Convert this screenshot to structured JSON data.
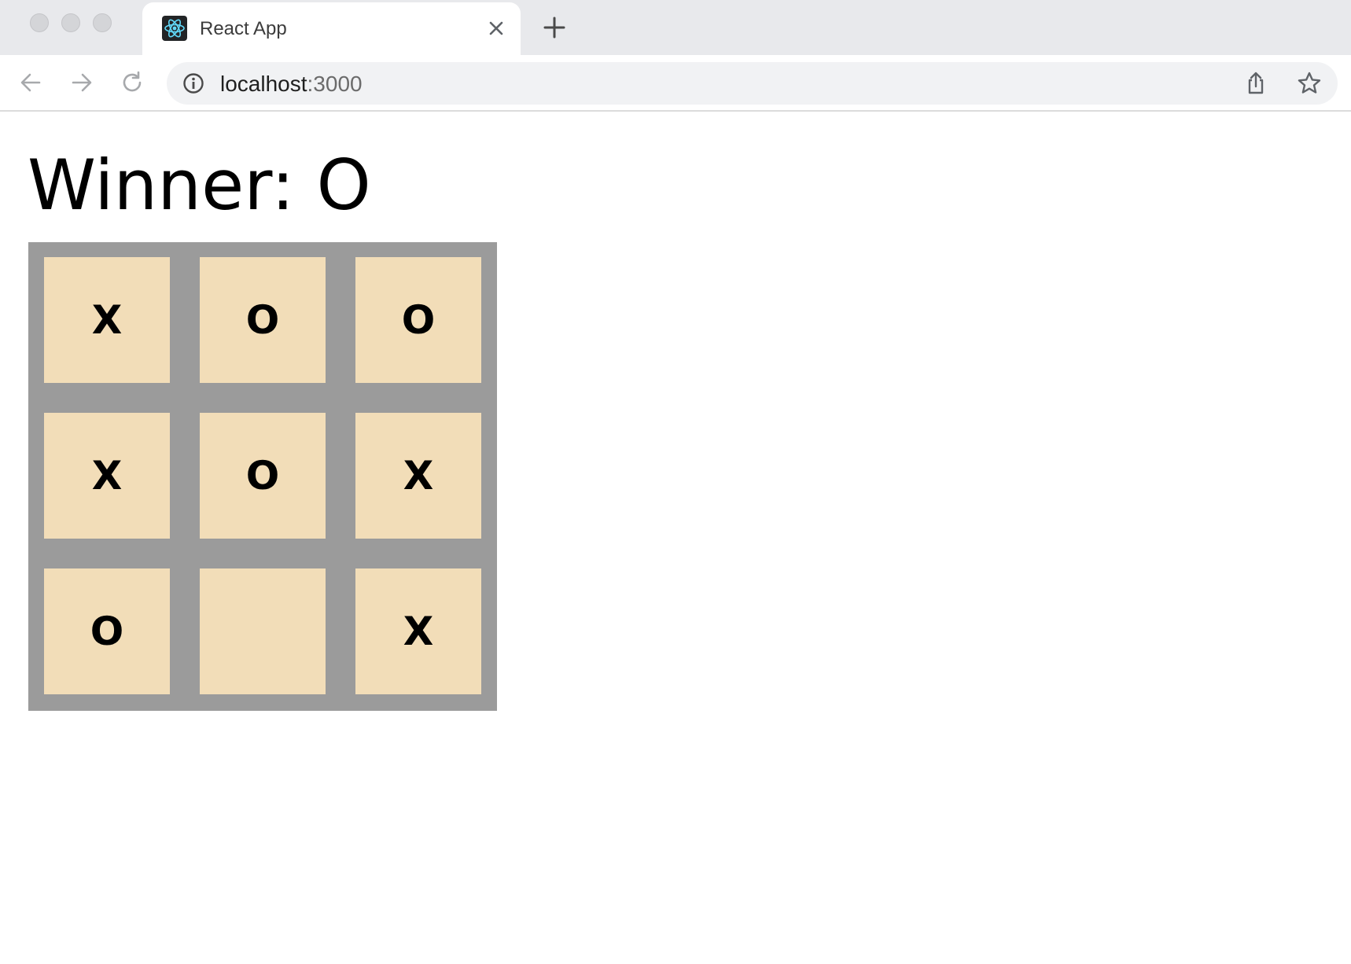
{
  "browser": {
    "tab": {
      "title": "React App",
      "favicon": "react-logo-icon"
    },
    "address": {
      "host": "localhost",
      "port": ":3000"
    },
    "colors": {
      "tabbar_bg": "#e8e9ec",
      "omnibox_bg": "#f1f2f4"
    }
  },
  "game": {
    "status": "Winner: O",
    "squares": [
      "X",
      "O",
      "O",
      "X",
      "O",
      "X",
      "O",
      "",
      "X"
    ],
    "colors": {
      "board_bg": "#9b9b9b",
      "square_bg": "#f2ddb8"
    }
  }
}
